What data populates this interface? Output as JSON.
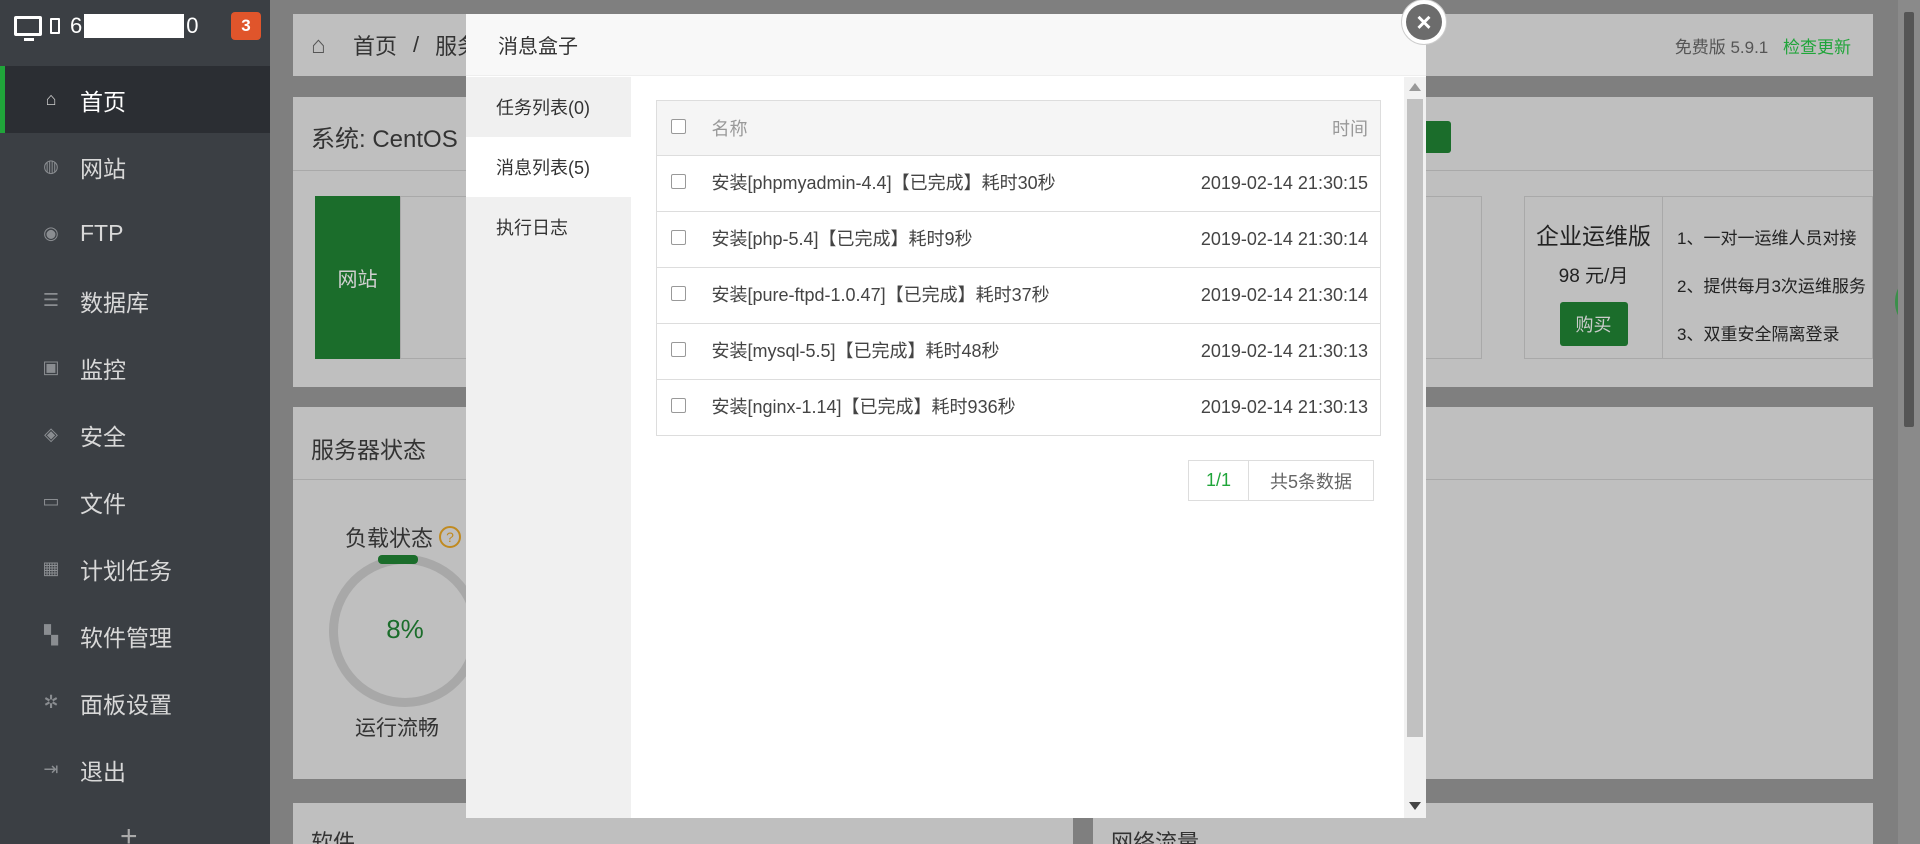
{
  "sidebar": {
    "host_prefix": "6",
    "host_suffix": "0",
    "badge": "3",
    "items": [
      {
        "label": "首页",
        "icon": "home-icon",
        "glyph": "⌂"
      },
      {
        "label": "网站",
        "icon": "globe-icon",
        "glyph": "◍"
      },
      {
        "label": "FTP",
        "icon": "ftp-icon",
        "glyph": "◉"
      },
      {
        "label": "数据库",
        "icon": "database-icon",
        "glyph": "☰"
      },
      {
        "label": "监控",
        "icon": "monitor-icon",
        "glyph": "▣"
      },
      {
        "label": "安全",
        "icon": "shield-icon",
        "glyph": "◈"
      },
      {
        "label": "文件",
        "icon": "folder-icon",
        "glyph": "▭"
      },
      {
        "label": "计划任务",
        "icon": "calendar-icon",
        "glyph": "▦"
      },
      {
        "label": "软件管理",
        "icon": "grid-icon",
        "glyph": "▚"
      },
      {
        "label": "面板设置",
        "icon": "gear-icon",
        "glyph": "✲"
      },
      {
        "label": "退出",
        "icon": "logout-icon",
        "glyph": "⇥"
      }
    ],
    "add": "+"
  },
  "header": {
    "home": "首页",
    "sep": "/",
    "current": "服务",
    "version": "免费版 5.9.1",
    "update": "检查更新"
  },
  "system": {
    "title": "系统: CentOS",
    "site_tile": "网站",
    "enterprise": {
      "name": "企业运维版",
      "price": "98 元/月",
      "buy": "购买",
      "features": [
        "1、一对一运维人员对接",
        "2、提供每月3次运维服务",
        "3、双重安全隔离登录"
      ]
    }
  },
  "server": {
    "title": "服务器状态",
    "load_label": "负载状态",
    "help": "?",
    "load_pct": "8%",
    "load_state": "运行流畅"
  },
  "bottom": {
    "left_title": "软件",
    "right_title": "网络流量"
  },
  "modal": {
    "title": "消息盒子",
    "close": "×",
    "tabs": [
      "任务列表(0)",
      "消息列表(5)",
      "执行日志"
    ],
    "columns": {
      "name": "名称",
      "time": "时间"
    },
    "rows": [
      {
        "name": "安装[phpmyadmin-4.4]【已完成】耗时30秒",
        "time": "2019-02-14 21:30:15"
      },
      {
        "name": "安装[php-5.4]【已完成】耗时9秒",
        "time": "2019-02-14 21:30:14"
      },
      {
        "name": "安装[pure-ftpd-1.0.47]【已完成】耗时37秒",
        "time": "2019-02-14 21:30:14"
      },
      {
        "name": "安装[mysql-5.5]【已完成】耗时48秒",
        "time": "2019-02-14 21:30:13"
      },
      {
        "name": "安装[nginx-1.14]【已完成】耗时936秒",
        "time": "2019-02-14 21:30:13"
      }
    ],
    "pager": {
      "page": "1/1",
      "total": "共5条数据"
    }
  },
  "colors": {
    "accent": "#20a53a",
    "sidebar": "#3b3f44",
    "badge": "#e0552b"
  }
}
